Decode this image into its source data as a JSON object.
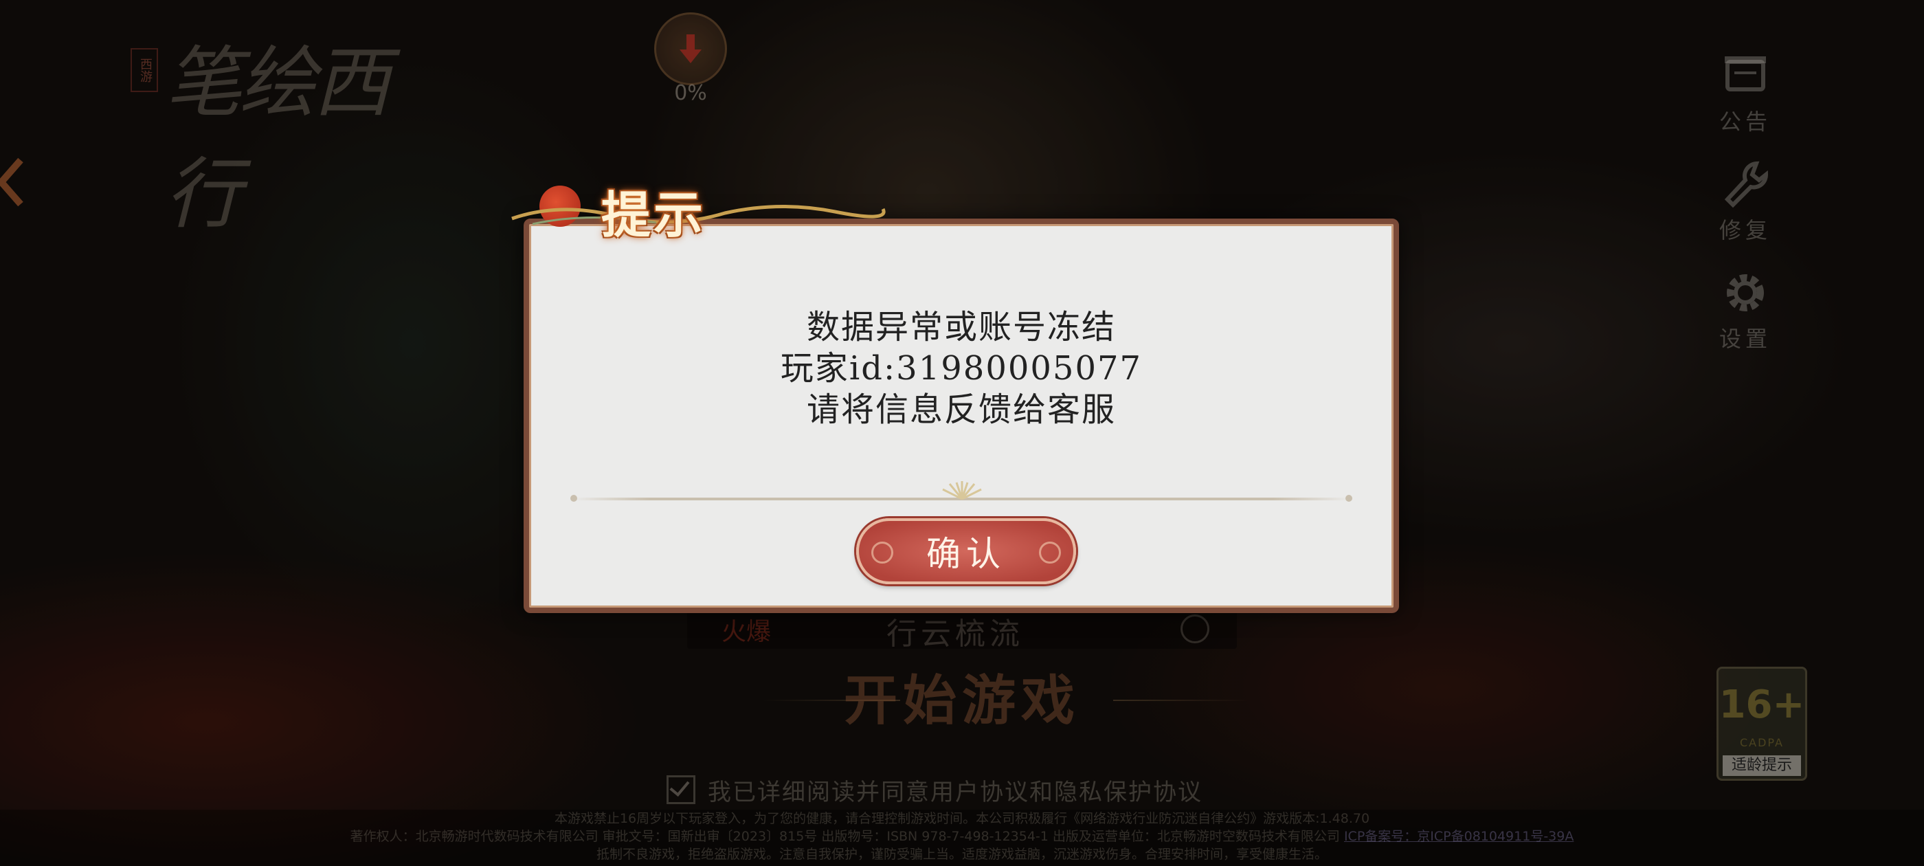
{
  "logo": {
    "seal": "西游",
    "text": "笔绘西行"
  },
  "download": {
    "percent": "0%"
  },
  "right_menu": [
    {
      "label": "公告",
      "icon": "notice-icon"
    },
    {
      "label": "修复",
      "icon": "repair-icon"
    },
    {
      "label": "设置",
      "icon": "gear-icon"
    }
  ],
  "server": {
    "tag": "火爆",
    "name": "行云梳流"
  },
  "start_button": "开始游戏",
  "agreement": "我已详细阅读并同意用户协议和隐私保护协议",
  "age_rating": {
    "number": "16+",
    "sub": "CADPA",
    "label": "适龄提示"
  },
  "footer": {
    "line1": "本游戏禁止16周岁以下玩家登入，为了您的健康，请合理控制游戏时间。本公司积极履行《网络游戏行业防沉迷自律公约》游戏版本:1.48.70",
    "line2": "著作权人：北京畅游时代数码技术有限公司 审批文号：国新出审〔2023〕815号 出版物号：ISBN 978-7-498-12354-1 出版及运营单位：北京畅游时空数码技术有限公司",
    "icp": "ICP备案号：京ICP备08104911号-39A",
    "line3": "抵制不良游戏，拒绝盗版游戏。注意自我保护，谨防受骗上当。适度游戏益脑，沉迷游戏伤身。合理安排时间，享受健康生活。"
  },
  "dialog": {
    "title": "提示",
    "message_line1": "数据异常或账号冻结",
    "message_line2": "玩家id:31980005077",
    "message_line3": "请将信息反馈给客服",
    "confirm": "确认"
  }
}
